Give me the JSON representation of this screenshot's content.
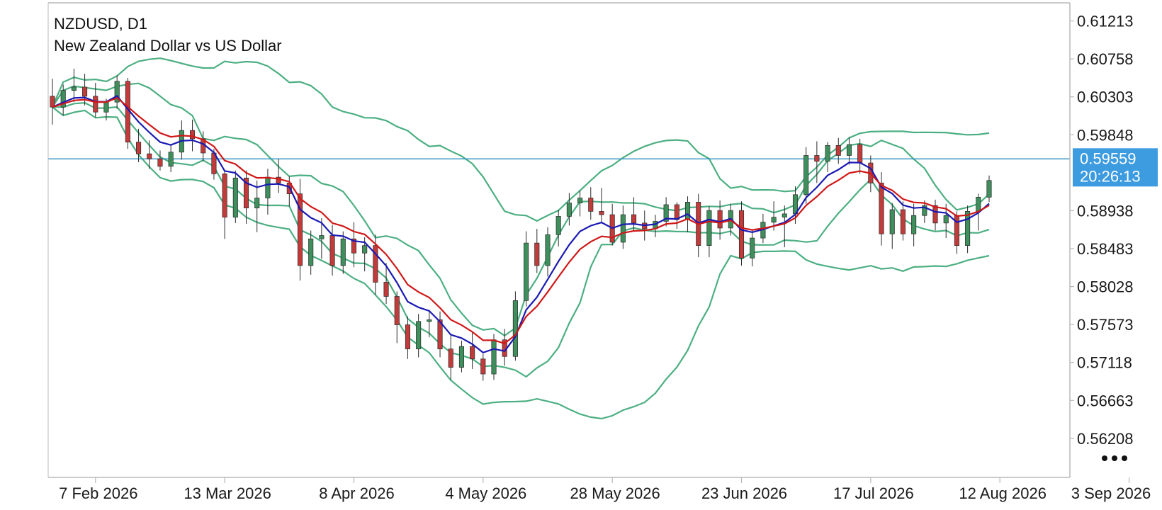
{
  "header": {
    "symbol_line": "NZDUSD, D1",
    "description": "New Zealand Dollar vs US Dollar"
  },
  "price_tag": {
    "price": "0.59559",
    "countdown": "20:26:13"
  },
  "colors": {
    "bull": "#3f8f5c",
    "bear": "#c23b3b",
    "bands": "#4caf82",
    "ma_fast": "#1a1ab3",
    "ma_slow": "#d01818",
    "price_line": "#2a8fbf",
    "price_tag_bg": "#3d9be0",
    "axis": "#b8b8b8"
  },
  "icons": {
    "more": "more-dots-icon"
  },
  "chart_data": {
    "type": "candlestick",
    "symbol": "NZDUSD",
    "timeframe": "D1",
    "ylim": [
      0.5574,
      0.6143
    ],
    "y_ticks": [
      "0.61213",
      "0.60758",
      "0.60303",
      "0.59848",
      "0.59559",
      "0.58938",
      "0.58483",
      "0.58028",
      "0.57573",
      "0.57118",
      "0.56663",
      "0.56208"
    ],
    "x_labels": [
      {
        "label": "7 Feb 2026",
        "index": 4
      },
      {
        "label": "13 Mar 2026",
        "index": 16
      },
      {
        "label": "8 Apr 2026",
        "index": 28
      },
      {
        "label": "4 May 2026",
        "index": 40
      },
      {
        "label": "28 May 2026",
        "index": 52
      },
      {
        "label": "23 Jun 2026",
        "index": 64
      },
      {
        "label": "17 Jul 2026",
        "index": 76
      },
      {
        "label": "12 Aug 2026",
        "index": 88
      },
      {
        "label": "3 Sep 2026",
        "index": 100
      }
    ],
    "current_price": 0.59559,
    "ohlc": [
      [
        0.6031,
        0.6052,
        0.5997,
        0.6018
      ],
      [
        0.6018,
        0.6045,
        0.6008,
        0.6038
      ],
      [
        0.6038,
        0.6064,
        0.6024,
        0.6042
      ],
      [
        0.6042,
        0.6058,
        0.602,
        0.6031
      ],
      [
        0.6031,
        0.6047,
        0.6006,
        0.6012
      ],
      [
        0.6012,
        0.6028,
        0.6002,
        0.6024
      ],
      [
        0.6024,
        0.6056,
        0.6016,
        0.6049
      ],
      [
        0.6049,
        0.6053,
        0.5968,
        0.5976
      ],
      [
        0.5976,
        0.5992,
        0.5952,
        0.5962
      ],
      [
        0.5962,
        0.5978,
        0.5944,
        0.5956
      ],
      [
        0.5956,
        0.5966,
        0.5942,
        0.5947
      ],
      [
        0.5947,
        0.5972,
        0.594,
        0.5964
      ],
      [
        0.5964,
        0.6002,
        0.5955,
        0.599
      ],
      [
        0.599,
        0.6003,
        0.5965,
        0.598
      ],
      [
        0.598,
        0.5989,
        0.5953,
        0.5963
      ],
      [
        0.5963,
        0.5968,
        0.5931,
        0.5938
      ],
      [
        0.5938,
        0.5942,
        0.586,
        0.5886
      ],
      [
        0.5886,
        0.5942,
        0.5879,
        0.5933
      ],
      [
        0.5933,
        0.5942,
        0.5878,
        0.5897
      ],
      [
        0.5897,
        0.593,
        0.5868,
        0.5909
      ],
      [
        0.5909,
        0.5944,
        0.5889,
        0.5934
      ],
      [
        0.5934,
        0.5956,
        0.5915,
        0.5927
      ],
      [
        0.5927,
        0.5935,
        0.5899,
        0.5914
      ],
      [
        0.5914,
        0.5932,
        0.581,
        0.5828
      ],
      [
        0.5828,
        0.587,
        0.5817,
        0.586
      ],
      [
        0.586,
        0.5885,
        0.5836,
        0.5864
      ],
      [
        0.5864,
        0.5877,
        0.5816,
        0.5828
      ],
      [
        0.5828,
        0.5869,
        0.5818,
        0.586
      ],
      [
        0.586,
        0.588,
        0.5826,
        0.5843
      ],
      [
        0.5843,
        0.5862,
        0.5821,
        0.5852
      ],
      [
        0.5852,
        0.5865,
        0.5793,
        0.5808
      ],
      [
        0.5808,
        0.5831,
        0.5782,
        0.5791
      ],
      [
        0.5791,
        0.5797,
        0.5735,
        0.5757
      ],
      [
        0.5757,
        0.5767,
        0.5716,
        0.5728
      ],
      [
        0.5728,
        0.577,
        0.5718,
        0.5761
      ],
      [
        0.5761,
        0.5775,
        0.5742,
        0.5763
      ],
      [
        0.5763,
        0.5773,
        0.5718,
        0.5728
      ],
      [
        0.5728,
        0.5744,
        0.5691,
        0.5706
      ],
      [
        0.5706,
        0.5738,
        0.57,
        0.5731
      ],
      [
        0.5731,
        0.5748,
        0.5704,
        0.5716
      ],
      [
        0.5716,
        0.5722,
        0.569,
        0.5698
      ],
      [
        0.5698,
        0.5746,
        0.5691,
        0.5739
      ],
      [
        0.5739,
        0.5752,
        0.5708,
        0.5719
      ],
      [
        0.5719,
        0.5797,
        0.5714,
        0.5786
      ],
      [
        0.5786,
        0.5869,
        0.5779,
        0.5855
      ],
      [
        0.5855,
        0.5872,
        0.5819,
        0.5828
      ],
      [
        0.5828,
        0.5874,
        0.5815,
        0.5865
      ],
      [
        0.5865,
        0.5895,
        0.5851,
        0.5887
      ],
      [
        0.5887,
        0.5915,
        0.5876,
        0.5903
      ],
      [
        0.5903,
        0.5918,
        0.5887,
        0.5909
      ],
      [
        0.5909,
        0.5922,
        0.5883,
        0.5893
      ],
      [
        0.5893,
        0.5921,
        0.588,
        0.5889
      ],
      [
        0.5889,
        0.5902,
        0.5852,
        0.5856
      ],
      [
        0.5856,
        0.59,
        0.5848,
        0.5889
      ],
      [
        0.5889,
        0.591,
        0.5869,
        0.5879
      ],
      [
        0.5879,
        0.5894,
        0.5858,
        0.5872
      ],
      [
        0.5872,
        0.5889,
        0.5862,
        0.5881
      ],
      [
        0.5881,
        0.591,
        0.5875,
        0.5901
      ],
      [
        0.5901,
        0.5904,
        0.5872,
        0.5883
      ],
      [
        0.5883,
        0.5911,
        0.5868,
        0.5904
      ],
      [
        0.5904,
        0.5914,
        0.5838,
        0.5852
      ],
      [
        0.5852,
        0.5899,
        0.5838,
        0.5894
      ],
      [
        0.5894,
        0.5906,
        0.5859,
        0.5873
      ],
      [
        0.5873,
        0.5902,
        0.5864,
        0.5894
      ],
      [
        0.5894,
        0.5905,
        0.5828,
        0.5837
      ],
      [
        0.5837,
        0.587,
        0.5827,
        0.5861
      ],
      [
        0.5861,
        0.589,
        0.5855,
        0.588
      ],
      [
        0.588,
        0.5905,
        0.587,
        0.5886
      ],
      [
        0.5886,
        0.59,
        0.585,
        0.589
      ],
      [
        0.589,
        0.5923,
        0.5878,
        0.5913
      ],
      [
        0.5913,
        0.597,
        0.5902,
        0.596
      ],
      [
        0.596,
        0.5977,
        0.5927,
        0.5953
      ],
      [
        0.5953,
        0.5976,
        0.594,
        0.5972
      ],
      [
        0.5972,
        0.5981,
        0.595,
        0.596
      ],
      [
        0.596,
        0.5982,
        0.5949,
        0.5973
      ],
      [
        0.5973,
        0.598,
        0.5938,
        0.5951
      ],
      [
        0.5951,
        0.596,
        0.5916,
        0.5927
      ],
      [
        0.5927,
        0.594,
        0.5852,
        0.5866
      ],
      [
        0.5866,
        0.5903,
        0.5848,
        0.5895
      ],
      [
        0.5895,
        0.5905,
        0.5858,
        0.5866
      ],
      [
        0.5866,
        0.5902,
        0.5851,
        0.5888
      ],
      [
        0.5888,
        0.5906,
        0.5879,
        0.59
      ],
      [
        0.59,
        0.5907,
        0.587,
        0.5879
      ],
      [
        0.5879,
        0.5902,
        0.5861,
        0.5888
      ],
      [
        0.5888,
        0.5893,
        0.5842,
        0.5852
      ],
      [
        0.5852,
        0.59,
        0.5843,
        0.5893
      ],
      [
        0.5893,
        0.5914,
        0.587,
        0.591
      ],
      [
        0.591,
        0.5936,
        0.5904,
        0.593
      ]
    ]
  }
}
